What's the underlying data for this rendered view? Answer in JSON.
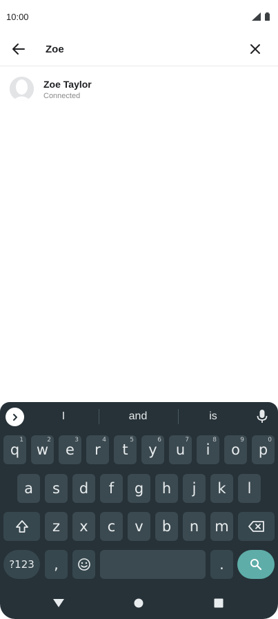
{
  "status_bar": {
    "time": "10:00"
  },
  "search": {
    "query": "Zoe"
  },
  "results": [
    {
      "name": "Zoe Taylor",
      "status": "Connected"
    }
  ],
  "keyboard": {
    "suggestions": [
      "I",
      "and",
      "is"
    ],
    "row1": [
      {
        "key": "q",
        "hint": "1"
      },
      {
        "key": "w",
        "hint": "2"
      },
      {
        "key": "e",
        "hint": "3"
      },
      {
        "key": "r",
        "hint": "4"
      },
      {
        "key": "t",
        "hint": "5"
      },
      {
        "key": "y",
        "hint": "6"
      },
      {
        "key": "u",
        "hint": "7"
      },
      {
        "key": "i",
        "hint": "8"
      },
      {
        "key": "o",
        "hint": "9"
      },
      {
        "key": "p",
        "hint": "0"
      }
    ],
    "row2": [
      "a",
      "s",
      "d",
      "f",
      "g",
      "h",
      "j",
      "k",
      "l"
    ],
    "row3": [
      "z",
      "x",
      "c",
      "v",
      "b",
      "n",
      "m"
    ],
    "symbols_label": "?123",
    "comma": ",",
    "period": "."
  },
  "colors": {
    "keyboard_bg": "#263238",
    "key_bg": "#3b4a50",
    "search_key": "#5eada8"
  }
}
